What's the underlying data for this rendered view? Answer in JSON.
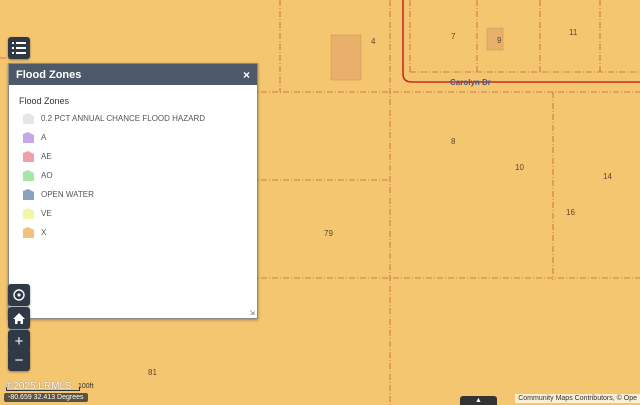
{
  "panel": {
    "title": "Flood Zones",
    "close_symbol": "×",
    "legend_title": "Flood Zones",
    "resize_symbol": "⇲",
    "items": [
      {
        "label": "0.2 PCT ANNUAL CHANCE FLOOD HAZARD",
        "color": "#e6e6e6"
      },
      {
        "label": "A",
        "color": "#c7a6e8"
      },
      {
        "label": "AE",
        "color": "#f2a0a8"
      },
      {
        "label": "AO",
        "color": "#a6e6a6"
      },
      {
        "label": "OPEN WATER",
        "color": "#8aa2c0"
      },
      {
        "label": "VE",
        "color": "#f5f5a8"
      },
      {
        "label": "X",
        "color": "#f2c27a"
      }
    ]
  },
  "map": {
    "background_color": "#f5c670",
    "parcel_numbers": [
      "4",
      "7",
      "9",
      "11",
      "8",
      "10",
      "14",
      "16",
      "79",
      "81"
    ],
    "road_name": "Carolyn Dr"
  },
  "toolbar": {
    "legend_icon": "list-icon",
    "locate_icon": "locate-icon",
    "home_icon": "home-icon",
    "zoom_in_label": "+",
    "zoom_out_label": "−"
  },
  "footer": {
    "scale_brand": "©2025 LRMLS",
    "scale_label": "100ft",
    "coordinates": "-80.659 32.413 Degrees",
    "attribution": "Community Maps Contributors, © Ope",
    "basemap_symbol": "▲"
  }
}
